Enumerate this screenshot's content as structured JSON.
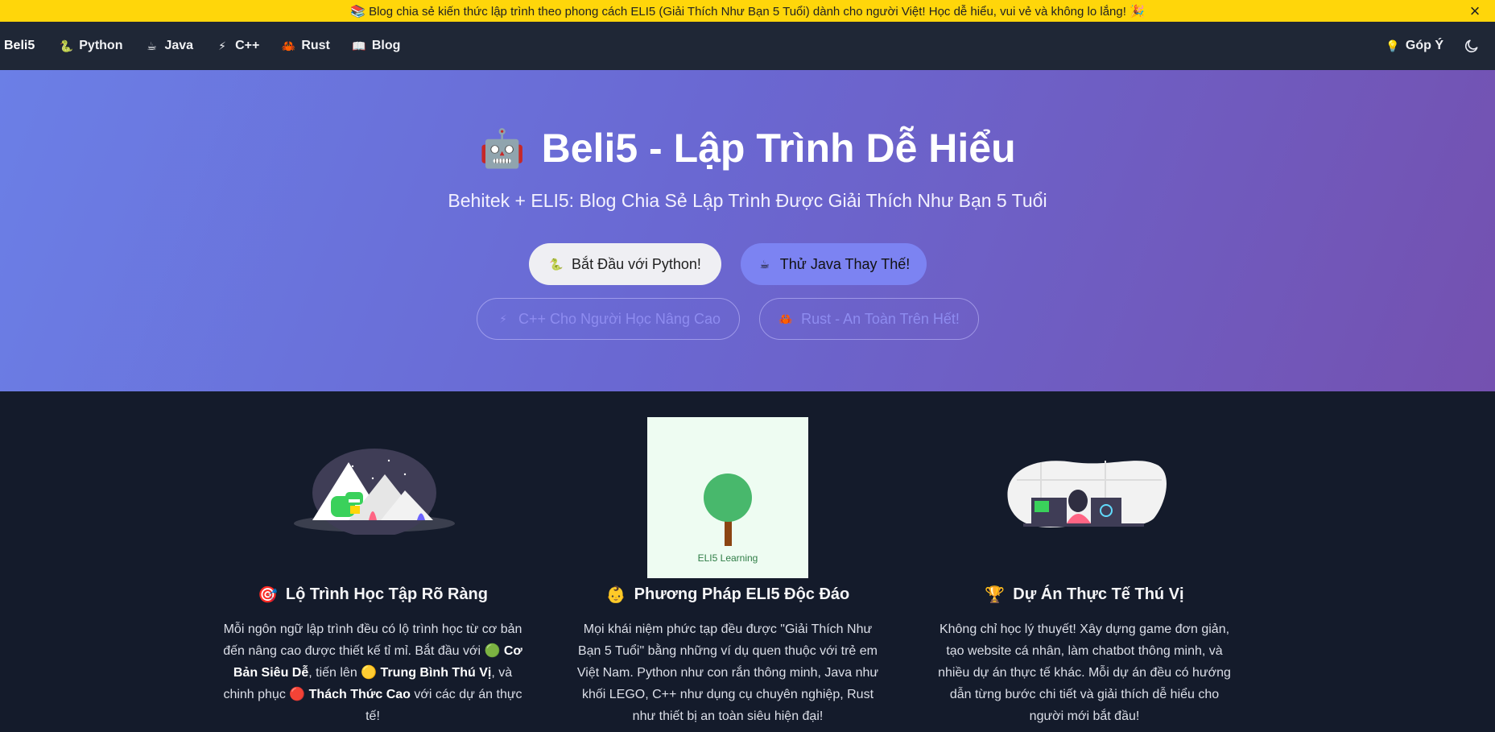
{
  "announcement": {
    "text": "📚 Blog chia sẻ kiến thức lập trình theo phong cách ELI5 (Giải Thích Như Bạn 5 Tuổi) dành cho người Việt! Học dễ hiểu, vui vẻ và không lo lắng! 🎉",
    "close_icon": "×"
  },
  "nav": {
    "brand": "Beli5",
    "items": [
      {
        "label": "Python",
        "icon": "🐍"
      },
      {
        "label": "Java",
        "icon": "☕"
      },
      {
        "label": "C++",
        "icon": "⚡"
      },
      {
        "label": "Rust",
        "icon": "🦀"
      },
      {
        "label": "Blog",
        "icon": "📖"
      }
    ],
    "feedback": {
      "label": "Góp Ý",
      "icon": "💡"
    },
    "theme_icon": "moon-icon"
  },
  "hero": {
    "title": "Beli5 - Lập Trình Dễ Hiểu",
    "title_icon": "🤖",
    "subtitle": "Behitek + ELI5: Blog Chia Sẻ Lập Trình Được Giải Thích Như Bạn 5 Tuổi",
    "buttons": [
      {
        "label": "Bắt Đầu với Python!",
        "icon": "🐍"
      },
      {
        "label": "Thử Java Thay Thế!",
        "icon": "☕"
      },
      {
        "label": "C++ Cho Người Học Nâng Cao",
        "icon": "⚡"
      },
      {
        "label": "Rust - An Toàn Trên Hết!",
        "icon": "🦀"
      }
    ]
  },
  "features": [
    {
      "icon": "🎯",
      "title": "Lộ Trình Học Tập Rõ Ràng",
      "text_a": "Mỗi ngôn ngữ lập trình đều có lộ trình học từ cơ bản đến nâng cao được thiết kế tỉ mỉ. Bắt đầu với ",
      "level1_icon": "🟢",
      "level1": "Cơ Bản Siêu Dễ",
      "text_b": ", tiến lên ",
      "level2_icon": "🟡",
      "level2": "Trung Bình Thú Vị",
      "text_c": ", và chinh phục ",
      "level3_icon": "🔴",
      "level3": "Thách Thức Cao",
      "text_d": " với các dự án thực tế!"
    },
    {
      "icon": "👶",
      "title": "Phương Pháp ELI5 Độc Đáo",
      "image_caption": "ELI5 Learning",
      "text": "Mọi khái niệm phức tạp đều được \"Giải Thích Như Bạn 5 Tuổi\" bằng những ví dụ quen thuộc với trẻ em Việt Nam. Python như con rắn thông minh, Java như khối LEGO, C++ như dụng cụ chuyên nghiệp, Rust như thiết bị an toàn siêu hiện đại!"
    },
    {
      "icon": "🏆",
      "title": "Dự Án Thực Tế Thú Vị",
      "text": "Không chỉ học lý thuyết! Xây dựng game đơn giản, tạo website cá nhân, làm chatbot thông minh, và nhiều dự án thực tế khác. Mỗi dự án đều có hướng dẫn từng bước chi tiết và giải thích dễ hiểu cho người mới bắt đầu!"
    }
  ]
}
